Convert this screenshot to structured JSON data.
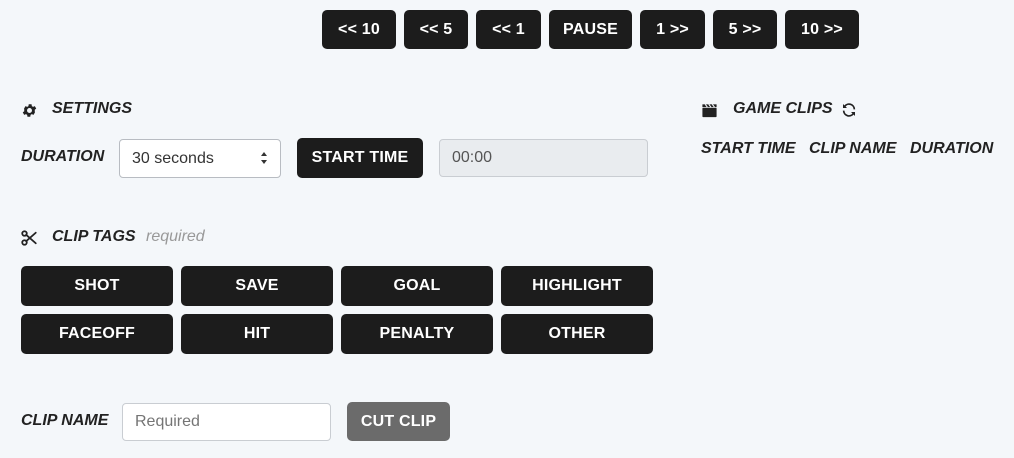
{
  "playback": {
    "back10": "<< 10",
    "back5": "<< 5",
    "back1": "<< 1",
    "pause": "PAUSE",
    "fwd1": "1 >>",
    "fwd5": "5 >>",
    "fwd10": "10 >>"
  },
  "settings": {
    "title": "SETTINGS",
    "duration_label": "DURATION",
    "duration_value": "30 seconds",
    "start_time_button": "START TIME",
    "start_time_value": "00:00"
  },
  "clip_tags": {
    "title": "CLIP TAGS",
    "hint": "required",
    "tags": [
      "SHOT",
      "SAVE",
      "GOAL",
      "HIGHLIGHT",
      "FACEOFF",
      "HIT",
      "PENALTY",
      "OTHER"
    ]
  },
  "clip_name": {
    "label": "CLIP NAME",
    "placeholder": "Required",
    "cut_button": "CUT CLIP"
  },
  "game_clips": {
    "title": "GAME CLIPS",
    "columns": [
      "START TIME",
      "CLIP NAME",
      "DURATION"
    ]
  },
  "icons": {
    "settings": "gear-icon",
    "clip_tags": "scissors-icon",
    "game_clips": "clapperboard-icon",
    "refresh": "refresh-icon"
  }
}
